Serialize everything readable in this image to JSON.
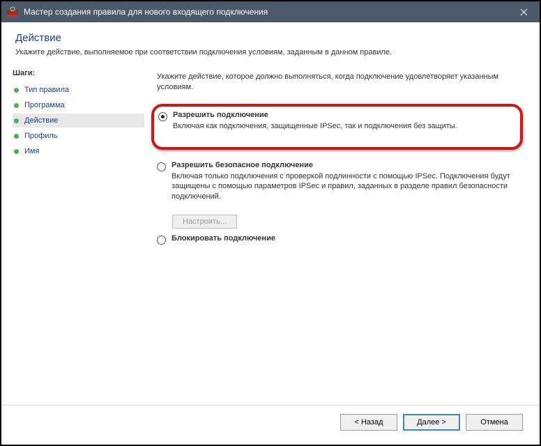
{
  "window": {
    "title": "Мастер создания правила для нового входящего подключения"
  },
  "header": {
    "title": "Действие",
    "subtitle": "Укажите действие, выполняемое при соответствии подключения условиям, заданным в данном правиле."
  },
  "sidebar": {
    "header": "Шаги:",
    "items": [
      {
        "label": "Тип правила"
      },
      {
        "label": "Программа"
      },
      {
        "label": "Действие"
      },
      {
        "label": "Профиль"
      },
      {
        "label": "Имя"
      }
    ],
    "active_index": 2
  },
  "content": {
    "intro": "Укажите действие, которое должно выполняться, когда подключение удовлетворяет указанным условиям.",
    "options": [
      {
        "title": "Разрешить подключение",
        "desc": "Включая как подключения, защищенные IPSec, так и подключения без защиты.",
        "selected": true
      },
      {
        "title": "Разрешить безопасное подключение",
        "desc": "Включая только подключения с проверкой подлинности с помощью IPSec. Подключения будут защищены с помощью параметров IPSec и правил, заданных в разделе правил безопасности подключений.",
        "selected": false
      },
      {
        "title": "Блокировать подключение",
        "desc": "",
        "selected": false
      }
    ],
    "configure_label": "Настроить..."
  },
  "footer": {
    "back": "< Назад",
    "next": "Далее >",
    "cancel": "Отмена"
  }
}
